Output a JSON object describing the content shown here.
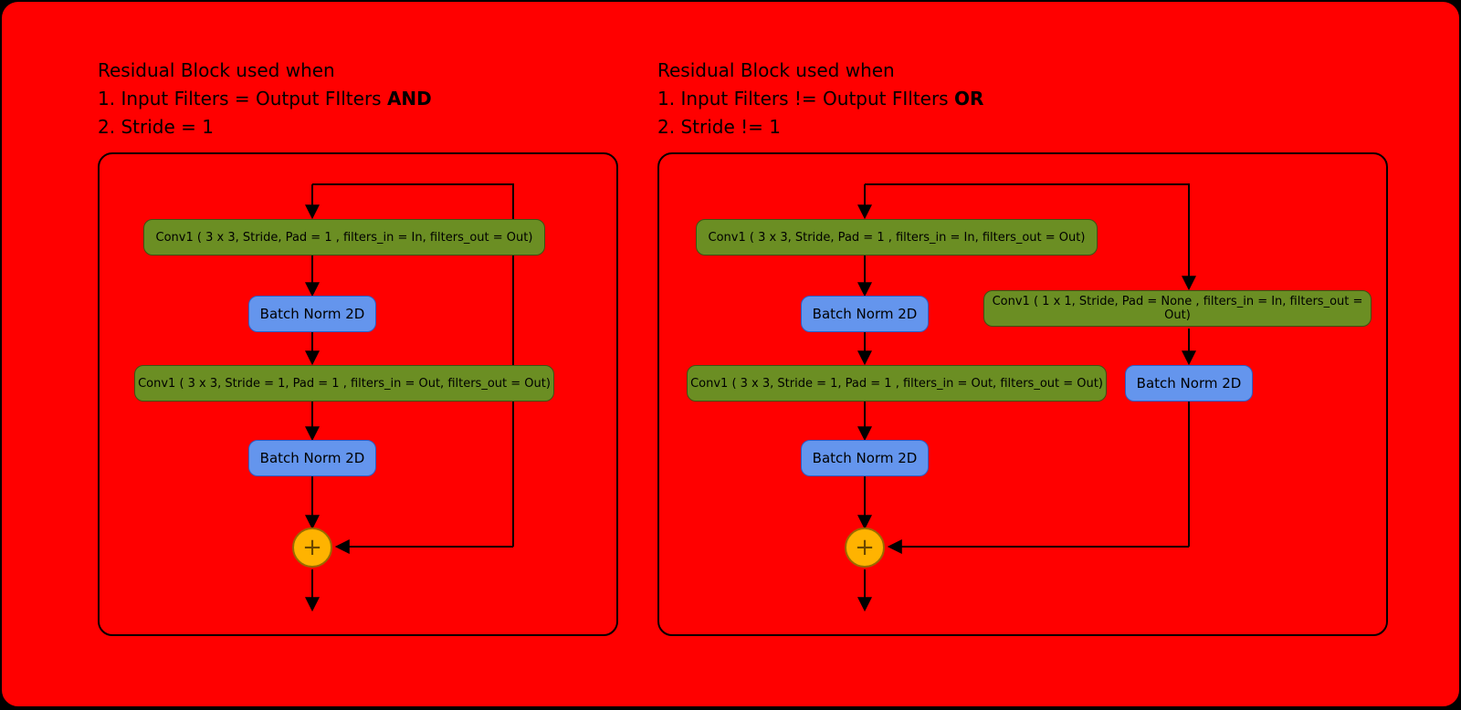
{
  "left": {
    "heading": {
      "title": "Residual Block used when",
      "line1_pre": "1. Input Filters = Output FIlters  ",
      "line1_bold": "AND",
      "line2": "2. Stride  = 1"
    },
    "conv1": "Conv1 ( 3 x 3,  Stride, Pad = 1 , filters_in = In, filters_out = Out)",
    "bn1": "Batch Norm 2D",
    "conv2": "Conv1 ( 3 x 3,  Stride = 1, Pad = 1 , filters_in = Out, filters_out = Out)",
    "bn2": "Batch Norm 2D",
    "plus": "+"
  },
  "right": {
    "heading": {
      "title": "Residual Block used when",
      "line1_pre": "1. Input Filters != Output FIlters ",
      "line1_bold": "OR",
      "line2": "2. Stride  != 1"
    },
    "conv1": "Conv1 ( 3 x 3,  Stride, Pad = 1 , filters_in = In, filters_out = Out)",
    "bn1": "Batch Norm 2D",
    "conv2": "Conv1 ( 3 x 3,  Stride = 1, Pad = 1 , filters_in = Out, filters_out = Out)",
    "bn2": "Batch Norm 2D",
    "conv1x1": "Conv1 ( 1 x 1,  Stride, Pad = None , filters_in = In, filters_out = Out)",
    "bn3": "Batch Norm 2D",
    "plus": "+"
  }
}
